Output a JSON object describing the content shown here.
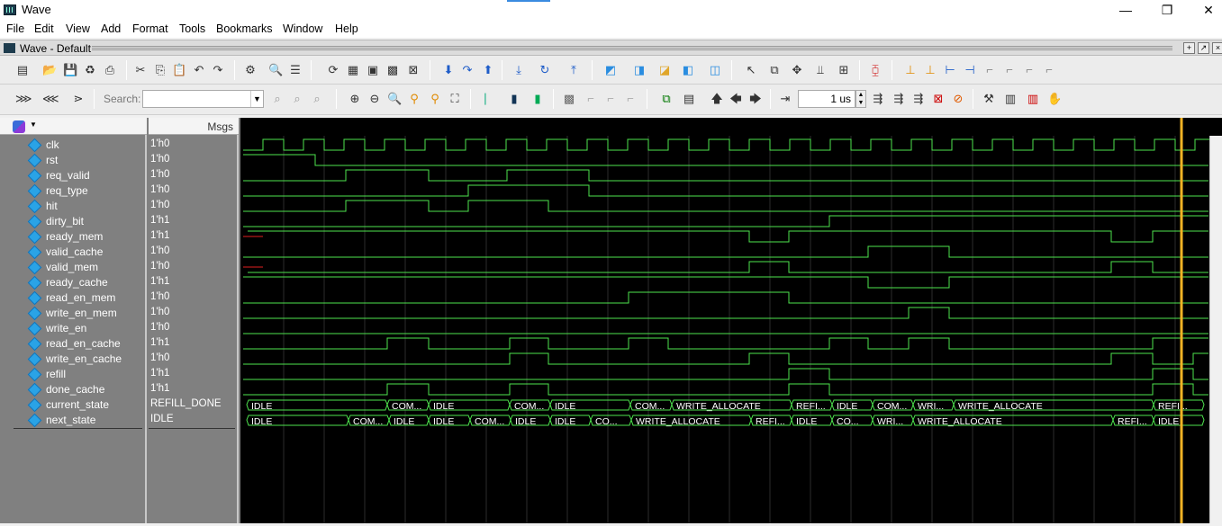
{
  "window": {
    "title": "Wave",
    "minimize": "—",
    "maximize": "❐",
    "close": "✕"
  },
  "menu": [
    "File",
    "Edit",
    "View",
    "Add",
    "Format",
    "Tools",
    "Bookmarks",
    "Window",
    "Help"
  ],
  "subwindow": {
    "title": "Wave - Default"
  },
  "toolbar2": {
    "search_label": "Search:",
    "search_value": ""
  },
  "toolbar2_time": {
    "value": "1 us"
  },
  "panes": {
    "msgs_header": "Msgs"
  },
  "signals": [
    {
      "name": "clk",
      "value": "1'h0"
    },
    {
      "name": "rst",
      "value": "1'h0"
    },
    {
      "name": "req_valid",
      "value": "1'h0"
    },
    {
      "name": "req_type",
      "value": "1'h0"
    },
    {
      "name": "hit",
      "value": "1'h0"
    },
    {
      "name": "dirty_bit",
      "value": "1'h1"
    },
    {
      "name": "ready_mem",
      "value": "1'h1"
    },
    {
      "name": "valid_cache",
      "value": "1'h0"
    },
    {
      "name": "valid_mem",
      "value": "1'h0"
    },
    {
      "name": "ready_cache",
      "value": "1'h1"
    },
    {
      "name": "read_en_mem",
      "value": "1'h0"
    },
    {
      "name": "write_en_mem",
      "value": "1'h0"
    },
    {
      "name": "write_en",
      "value": "1'h0"
    },
    {
      "name": "read_en_cache",
      "value": "1'h1"
    },
    {
      "name": "write_en_cache",
      "value": "1'h0"
    },
    {
      "name": "refill",
      "value": "1'h1"
    },
    {
      "name": "done_cache",
      "value": "1'h1"
    },
    {
      "name": "current_state",
      "value": "REFILL_DONE"
    },
    {
      "name": "next_state",
      "value": "IDLE"
    }
  ],
  "bus_labels": {
    "current_state": [
      {
        "t": 4,
        "label": "IDLE"
      },
      {
        "t": 160,
        "label": "COM..."
      },
      {
        "t": 206,
        "label": "IDLE"
      },
      {
        "t": 296,
        "label": "COM..."
      },
      {
        "t": 341,
        "label": "IDLE"
      },
      {
        "t": 430,
        "label": "COM..."
      },
      {
        "t": 476,
        "label": "WRITE_ALLOCATE"
      },
      {
        "t": 609,
        "label": "REFI..."
      },
      {
        "t": 654,
        "label": "IDLE"
      },
      {
        "t": 699,
        "label": "COM..."
      },
      {
        "t": 744,
        "label": "WRI..."
      },
      {
        "t": 789,
        "label": "WRITE_ALLOCATE"
      },
      {
        "t": 1011,
        "label": "REFI..."
      }
    ],
    "next_state": [
      {
        "t": 4,
        "label": "IDLE"
      },
      {
        "t": 117,
        "label": "COM..."
      },
      {
        "t": 162,
        "label": "IDLE"
      },
      {
        "t": 206,
        "label": "IDLE"
      },
      {
        "t": 252,
        "label": "COM..."
      },
      {
        "t": 297,
        "label": "IDLE"
      },
      {
        "t": 341,
        "label": "IDLE"
      },
      {
        "t": 386,
        "label": "CO..."
      },
      {
        "t": 431,
        "label": "WRITE_ALLOCATE"
      },
      {
        "t": 564,
        "label": "REFI..."
      },
      {
        "t": 609,
        "label": "IDLE"
      },
      {
        "t": 654,
        "label": "CO..."
      },
      {
        "t": 699,
        "label": "WRI..."
      },
      {
        "t": 744,
        "label": "WRITE_ALLOCATE"
      },
      {
        "t": 966,
        "label": "REFI..."
      },
      {
        "t": 1011,
        "label": "IDLE"
      }
    ]
  },
  "colors": {
    "wave": "#4ee44e",
    "cursor": "#f2b325",
    "gridline": "#2c2c2c",
    "background": "#000000"
  }
}
